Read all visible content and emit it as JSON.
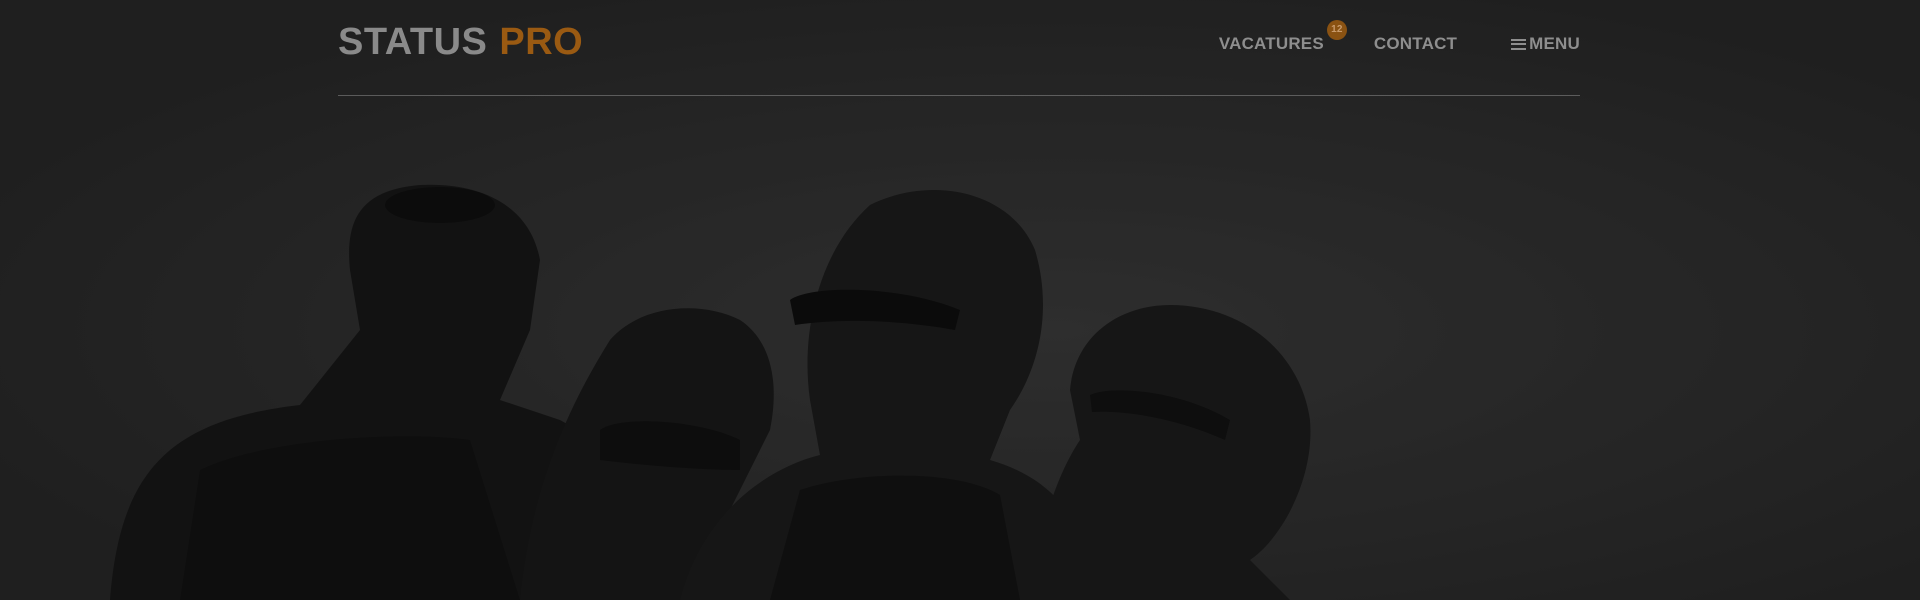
{
  "brand": {
    "name_part1": "STATUS",
    "name_part2": "PRO",
    "color_primary": "#8a8a8a",
    "color_accent": "#9a5a12"
  },
  "nav": {
    "items": [
      {
        "label": "VACATURES",
        "badge": "12"
      },
      {
        "label": "CONTACT"
      },
      {
        "label": "MENU",
        "icon": "hamburger-icon"
      }
    ]
  },
  "hero": {
    "image": "group-of-friends-laughing-photo"
  }
}
